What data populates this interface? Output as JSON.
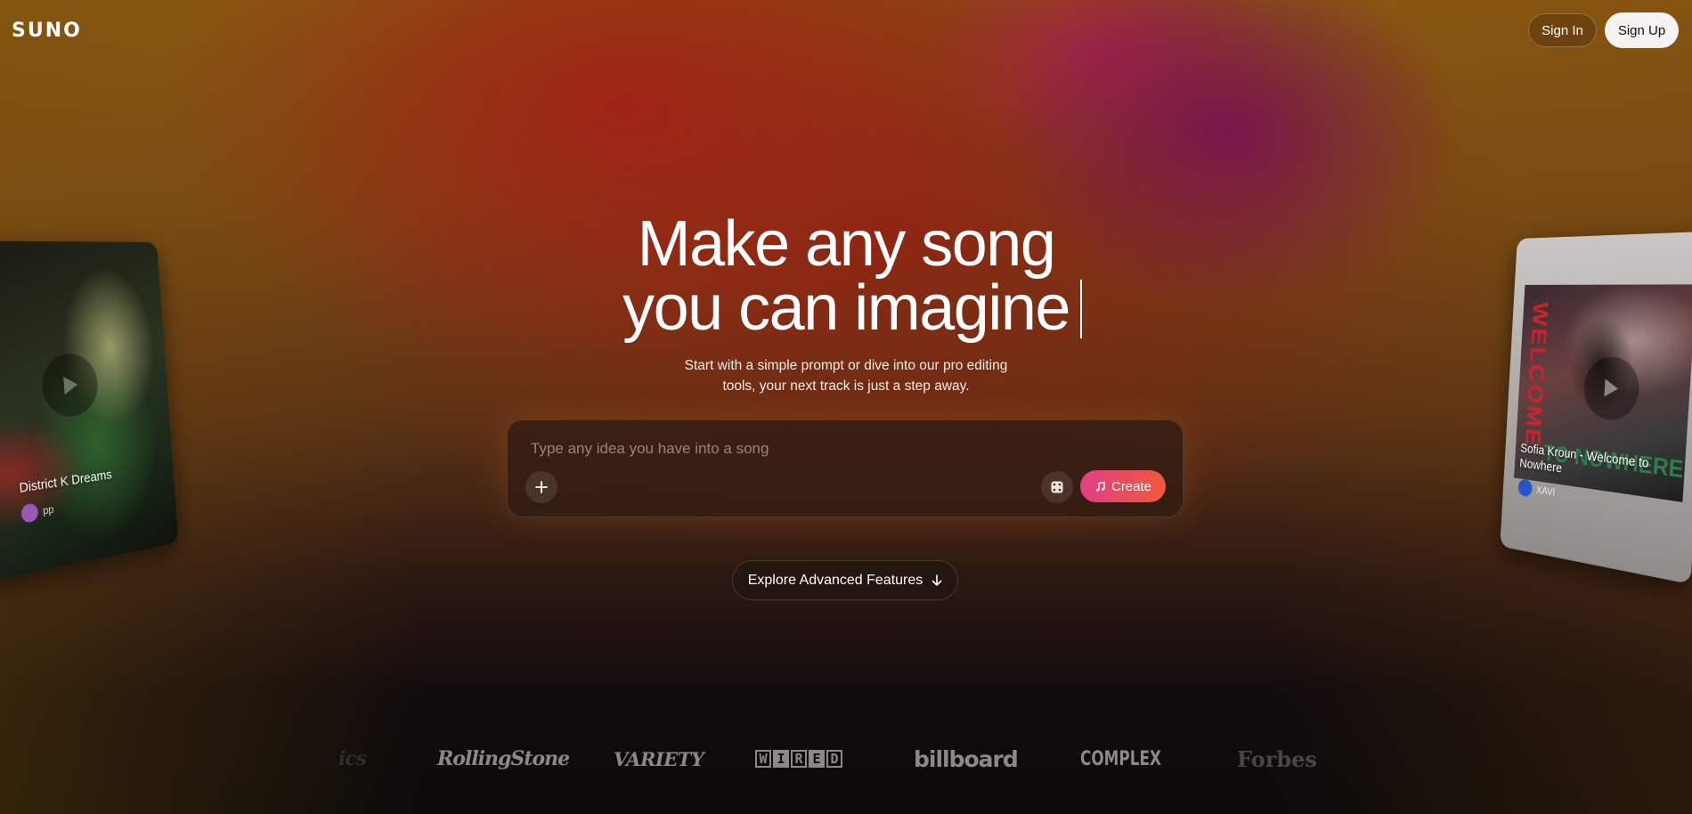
{
  "header": {
    "logo": "SUNO",
    "sign_in_label": "Sign In",
    "sign_up_label": "Sign Up"
  },
  "hero": {
    "title_line1": "Make any song",
    "title_line2": "you can imagine",
    "subtitle_line1": "Start with a simple prompt or dive into our pro editing",
    "subtitle_line2": "tools, your next track is just a step away."
  },
  "prompt": {
    "placeholder": "Type any idea you have into a song",
    "value": "",
    "create_label": "Create"
  },
  "explore": {
    "label": "Explore Advanced Features"
  },
  "cards": {
    "left": {
      "title": "District K Dreams",
      "user": "pp"
    },
    "right": {
      "title_line1": "Sofia Kroun - Welcome to",
      "title_line2": "Nowhere",
      "user": "XAVI",
      "art_text_vertical": "WELCOME",
      "art_text": "TO NOWHERE"
    }
  },
  "press": {
    "partial": "ics",
    "logos": [
      "RollingStone",
      "VARIETY",
      "WIRED",
      "billboard",
      "COMPLEX",
      "Forbes"
    ]
  },
  "colors": {
    "create_gradient_start": "#e23e86",
    "create_gradient_end": "#ee5a3a",
    "sign_up_bg": "#f5f3f1"
  }
}
